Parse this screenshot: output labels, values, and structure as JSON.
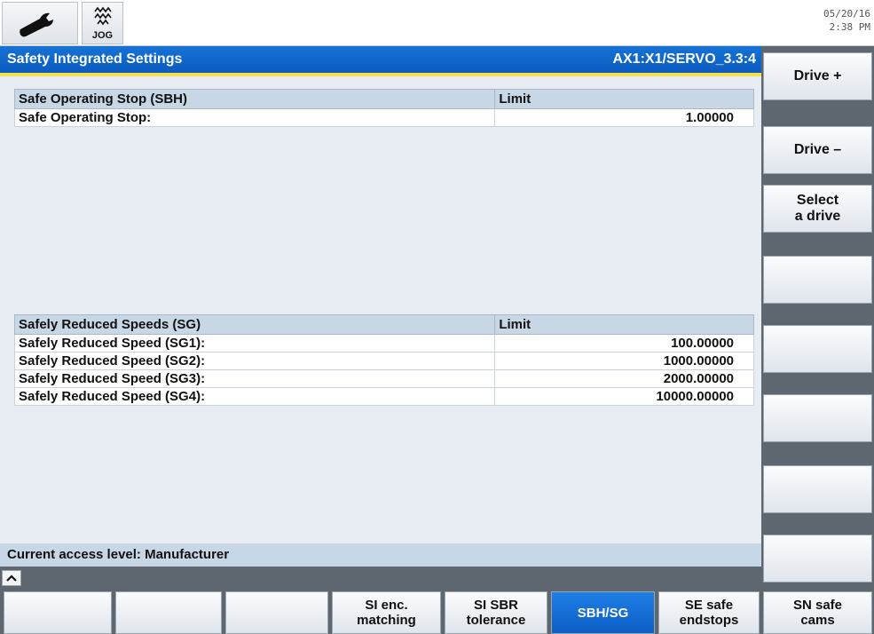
{
  "topbar": {
    "wrench_icon": "wrench-icon",
    "jog_icon": "jog-wave-icon",
    "jog_label": "JOG",
    "date": "05/20/16",
    "time": "2:38 PM"
  },
  "header": {
    "title": "Safety Integrated Settings",
    "axis": "AX1:X1/SERVO_3.3:4"
  },
  "sbh_table": {
    "col1": "Safe Operating Stop (SBH)",
    "col2": "Limit",
    "rows": [
      {
        "label": "Safe Operating Stop:",
        "value": "1.00000"
      }
    ]
  },
  "sg_table": {
    "col1": "Safely Reduced Speeds (SG)",
    "col2": "Limit",
    "rows": [
      {
        "label": "Safely Reduced Speed (SG1):",
        "value": "100.00000"
      },
      {
        "label": "Safely Reduced Speed (SG2):",
        "value": "1000.00000"
      },
      {
        "label": "Safely Reduced Speed (SG3):",
        "value": "2000.00000"
      },
      {
        "label": "Safely Reduced Speed (SG4):",
        "value": "10000.00000"
      }
    ]
  },
  "status": {
    "access": "Current access level: Manufacturer",
    "scroll_up_icon": "chevron-up-icon"
  },
  "vertical_softkeys": {
    "drive_plus": "Drive +",
    "drive_minus": "Drive –",
    "select_drive_line1": "Select",
    "select_drive_line2": "a drive"
  },
  "horizontal_softkeys": {
    "si_enc_line1": "SI enc.",
    "si_enc_line2": "matching",
    "si_sbr_line1": "SI SBR",
    "si_sbr_line2": "tolerance",
    "sbh_sg": "SBH/SG",
    "se_line1": "SE safe",
    "se_line2": "endstops",
    "sn_line1": "SN safe",
    "sn_line2": "cams"
  },
  "colors": {
    "header_blue": "#0b5bbf",
    "accent_yellow": "#f4e04c",
    "active_softkey": "#1f7ee6",
    "panel_gray": "#5e6670"
  }
}
